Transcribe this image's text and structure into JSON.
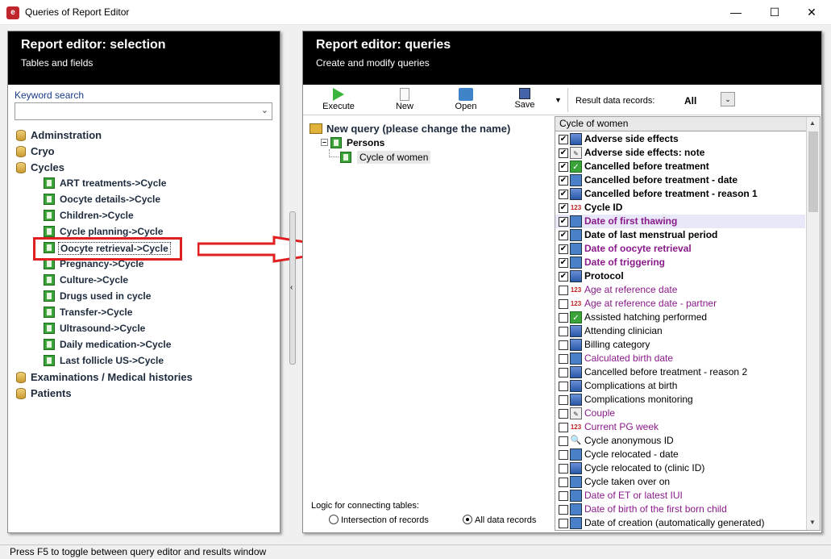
{
  "window": {
    "title": "Queries of Report Editor",
    "icon_name": "app-logo-icon",
    "controls": [
      "minimize",
      "maximize",
      "close"
    ]
  },
  "left_panel": {
    "title": "Report editor: selection",
    "subtitle": "Tables and fields",
    "keyword_label": "Keyword search",
    "keyword_value": "",
    "tree": [
      {
        "label": "Adminstration",
        "level": 0
      },
      {
        "label": "Cryo",
        "level": 0
      },
      {
        "label": "Cycles",
        "level": 0
      },
      {
        "label": "ART treatments->Cycle",
        "level": 1
      },
      {
        "label": "Oocyte details->Cycle",
        "level": 1
      },
      {
        "label": "Children->Cycle",
        "level": 1
      },
      {
        "label": "Cycle planning->Cycle",
        "level": 1
      },
      {
        "label": "Oocyte retrieval->Cycle",
        "level": 1,
        "selected": true
      },
      {
        "label": "Pregnancy->Cycle",
        "level": 1
      },
      {
        "label": "Culture->Cycle",
        "level": 1
      },
      {
        "label": "Drugs used in cycle",
        "level": 1
      },
      {
        "label": "Transfer->Cycle",
        "level": 1
      },
      {
        "label": "Ultrasound->Cycle",
        "level": 1
      },
      {
        "label": "Daily medication->Cycle",
        "level": 1
      },
      {
        "label": "Last follicle US->Cycle",
        "level": 1
      },
      {
        "label": "Examinations / Medical histories",
        "level": 0
      },
      {
        "label": "Patients",
        "level": 0
      }
    ],
    "highlight_color": "#e02020"
  },
  "right_panel": {
    "title": "Report editor: queries",
    "subtitle": "Create and modify queries",
    "toolbar": {
      "execute": "Execute",
      "new": "New",
      "open": "Open",
      "save": "Save",
      "result_label": "Result data records:",
      "result_value": "All"
    },
    "query_tree": {
      "root": "New query (please change the name)",
      "persons": "Persons",
      "cycle": "Cycle of women"
    },
    "field_list": {
      "header": "Cycle of women",
      "fields": [
        {
          "label": "Adverse side effects",
          "checked": true,
          "bold": true,
          "color": "dark",
          "icon": "list"
        },
        {
          "label": "Adverse side effects: note",
          "checked": true,
          "bold": true,
          "color": "dark",
          "icon": "note"
        },
        {
          "label": "Cancelled before treatment",
          "checked": true,
          "bold": true,
          "color": "dark",
          "icon": "check"
        },
        {
          "label": "Cancelled before treatment - date",
          "checked": true,
          "bold": true,
          "color": "dark",
          "icon": "date"
        },
        {
          "label": "Cancelled before treatment - reason 1",
          "checked": true,
          "bold": true,
          "color": "dark",
          "icon": "list"
        },
        {
          "label": "Cycle ID",
          "checked": true,
          "bold": true,
          "color": "dark",
          "icon": "num"
        },
        {
          "label": "Date of first thawing",
          "checked": true,
          "bold": true,
          "color": "purple",
          "icon": "date",
          "highlighted": true
        },
        {
          "label": "Date of last menstrual period",
          "checked": true,
          "bold": true,
          "color": "dark",
          "icon": "date"
        },
        {
          "label": "Date of oocyte retrieval",
          "checked": true,
          "bold": true,
          "color": "purple",
          "icon": "date"
        },
        {
          "label": "Date of triggering",
          "checked": true,
          "bold": true,
          "color": "purple",
          "icon": "date"
        },
        {
          "label": "Protocol",
          "checked": true,
          "bold": true,
          "color": "dark",
          "icon": "list"
        },
        {
          "label": "Age at reference date",
          "checked": false,
          "bold": false,
          "color": "purple",
          "icon": "num"
        },
        {
          "label": "Age at reference date - partner",
          "checked": false,
          "bold": false,
          "color": "purple",
          "icon": "num"
        },
        {
          "label": "Assisted hatching performed",
          "checked": false,
          "bold": false,
          "color": "dark",
          "icon": "check"
        },
        {
          "label": "Attending clinician",
          "checked": false,
          "bold": false,
          "color": "dark",
          "icon": "list"
        },
        {
          "label": "Billing category",
          "checked": false,
          "bold": false,
          "color": "dark",
          "icon": "list"
        },
        {
          "label": "Calculated birth date",
          "checked": false,
          "bold": false,
          "color": "purple",
          "icon": "date"
        },
        {
          "label": "Cancelled before treatment - reason 2",
          "checked": false,
          "bold": false,
          "color": "dark",
          "icon": "list"
        },
        {
          "label": "Complications at birth",
          "checked": false,
          "bold": false,
          "color": "dark",
          "icon": "list"
        },
        {
          "label": "Complications monitoring",
          "checked": false,
          "bold": false,
          "color": "dark",
          "icon": "list"
        },
        {
          "label": "Couple",
          "checked": false,
          "bold": false,
          "color": "purple",
          "icon": "note"
        },
        {
          "label": "Current PG week",
          "checked": false,
          "bold": false,
          "color": "purple",
          "icon": "num"
        },
        {
          "label": "Cycle anonymous ID",
          "checked": false,
          "bold": false,
          "color": "dark",
          "icon": "key"
        },
        {
          "label": "Cycle relocated - date",
          "checked": false,
          "bold": false,
          "color": "dark",
          "icon": "date"
        },
        {
          "label": "Cycle relocated to (clinic ID)",
          "checked": false,
          "bold": false,
          "color": "dark",
          "icon": "list"
        },
        {
          "label": "Cycle taken over on",
          "checked": false,
          "bold": false,
          "color": "dark",
          "icon": "date"
        },
        {
          "label": "Date of ET or latest IUI",
          "checked": false,
          "bold": false,
          "color": "purple",
          "icon": "date"
        },
        {
          "label": "Date of birth of the first born child",
          "checked": false,
          "bold": false,
          "color": "purple",
          "icon": "date"
        },
        {
          "label": "Date of creation (automatically generated)",
          "checked": false,
          "bold": false,
          "color": "dark",
          "icon": "date"
        }
      ]
    },
    "logic": {
      "label": "Logic for connecting tables:",
      "option1": "Intersection of records",
      "option2": "All data records",
      "selected": "option2"
    }
  },
  "status_bar": {
    "text": "Press F5 to toggle between query editor and results window"
  },
  "colors": {
    "panel_header_bg": "#000000",
    "purple_text": "#8a1a8a",
    "dark_text": "#1d2b3d",
    "link_text": "#1a3a8a"
  }
}
